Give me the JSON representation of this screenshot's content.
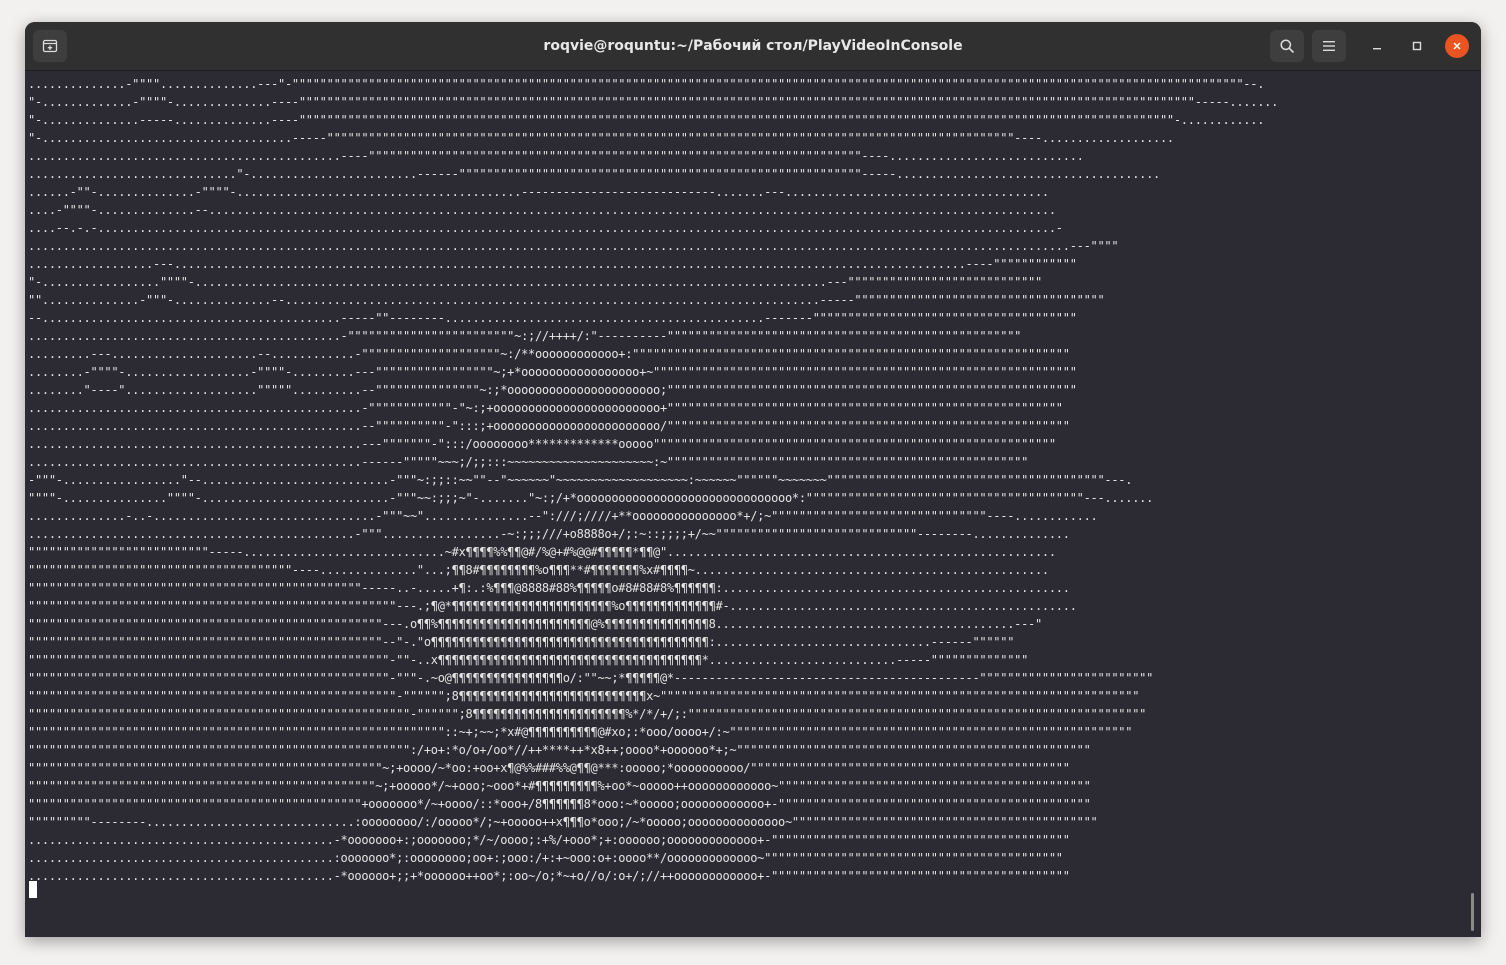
{
  "window": {
    "title": "roqvie@roquntu:~/Рабочий стол/PlayVideoInConsole"
  },
  "icons": {
    "new_tab": "new-tab-icon",
    "search": "search-icon",
    "menu": "hamburger-menu-icon",
    "minimize": "minimize-icon",
    "maximize": "maximize-icon",
    "close": "close-icon"
  },
  "colors": {
    "terminal_background": "#2c2a33",
    "terminal_text": "#e4e4e4",
    "close_button": "#e95420"
  },
  "terminal": {
    "lines": [
      "..............-\"\"\"\"..............---\"-\"\"\"\"\"\"\"\"\"\"\"\"\"\"\"\"\"\"\"\"\"\"\"\"\"\"\"\"\"\"\"\"\"\"\"\"\"\"\"\"\"\"\"\"\"\"\"\"\"\"\"\"\"\"\"\"\"\"\"\"\"\"\"\"\"\"\"\"\"\"\"\"\"\"\"\"\"\"\"\"\"\"\"\"\"\"\"\"\"\"\"\"\"\"\"\"\"\"\"\"\"\"\"\"\"\"\"\"\"\"\"\"\"\"\"\"\"\"\"\"\"\"\"\"\"\"\"\"\"\"\"\"\"\"\"\"\"--.",
      "\"-.............-\"\"\"\"-..............----\"\"\"\"\"\"\"\"\"\"\"\"\"\"\"\"\"\"\"\"\"\"\"\"\"\"\"\"\"\"\"\"\"\"\"\"\"\"\"\"\"\"\"\"\"\"\"\"\"\"\"\"\"\"\"\"\"\"\"\"\"\"\"\"\"\"\"\"\"\"\"\"\"\"\"\"\"\"\"\"\"\"\"\"\"\"\"\"\"\"\"\"\"\"\"\"\"\"\"\"\"\"\"\"\"\"\"\"\"\"\"\"\"\"\"\"\"\"\"\"\"\"\"\"\"\"\"\"\"-----.......",
      "\"-..............-----..............----\"\"\"\"\"\"\"\"\"\"\"\"\"\"\"\"\"\"\"\"\"\"\"\"\"\"\"\"\"\"\"\"\"\"\"\"\"\"\"\"\"\"\"\"\"\"\"\"\"\"\"\"\"\"\"\"\"\"\"\"\"\"\"\"\"\"\"\"\"\"\"\"\"\"\"\"\"\"\"\"\"\"\"\"\"\"\"\"\"\"\"\"\"\"\"\"\"\"\"\"\"\"\"\"\"\"\"\"\"\"\"\"\"\"\"\"\"\"\"\"\"\"\"\"\"\"-............",
      "\"-....................................-----\"\"\"\"\"\"\"\"\"\"\"\"\"\"\"\"\"\"\"\"\"\"\"\"\"\"\"\"\"\"\"\"\"\"\"\"\"\"\"\"\"\"\"\"\"\"\"\"\"\"\"\"\"\"\"\"\"\"\"\"\"\"\"\"\"\"\"\"\"\"\"\"\"\"\"\"\"\"\"\"\"\"\"\"\"\"\"\"\"\"\"\"\"\"\"\"\"\"\"----...................",
      ".............................................----\"\"\"\"\"\"\"\"\"\"\"\"\"\"\"\"\"\"\"\"\"\"\"\"\"\"\"\"\"\"\"\"\"\"\"\"\"\"\"\"\"\"\"\"\"\"\"\"\"\"\"\"\"\"\"\"\"\"\"\"\"\"\"\"\"\"\"\"\"\"\"----............................",
      "..............................\"-........................------\"\"\"\"\"\"\"\"\"\"\"\"\"\"\"\"\"\"\"\"\"\"\"\"\"\"\"\"\"\"\"\"\"\"\"\"\"\"\"\"\"\"\"\"\"\"\"\"\"\"\"\"\"\"\"\"\"\"-----......................................",
      "......-\"\"-..............-\"\"\"\"-.........................................----------------------------.......---......................................",
      "....-\"\"\"\"-..............--..........................................................................................................................",
      "....--.-.-..........................................................................................................................................-",
      "......................................................................................................................................................---\"\"\"\"",
      "..................---..................................................................................................................----\"\"\"\"\"\"\"\"\"\"\"\"",
      "\"-.................\"\"\"\"-...........................................................................................---\"\"\"\"\"\"\"\"\"\"\"\"\"\"\"\"\"\"\"\"\"\"\"\"\"\"\"\"",
      "\"\"..............-\"\"\"-..............--.............................................................................-----\"\"\"\"\"\"\"\"\"\"\"\"\"\"\"\"\"\"\"\"\"\"\"\"\"\"\"\"\"\"\"\"\"\"\"\"",
      "--...........................................-----\"\"--------..............................................-------\"\"\"\"\"\"\"\"\"\"\"\"\"\"\"\"\"\"\"\"\"\"\"\"\"\"\"\"\"\"\"\"\"\"\"\"\"\"",
      ".............................................-\"\"\"\"\"\"\"\"\"\"\"\"\"\"\"\"\"\"\"\"\"\"\"\"~:;//++++/:\"----------\"\"\"\"\"\"\"\"\"\"\"\"\"\"\"\"\"\"\"\"\"\"\"\"\"\"\"\"\"\"\"\"\"\"\"\"\"\"\"\"\"\"\"\"\"\"\"\"\"\"\"",
      ".........---.....................--............-\"\"\"\"\"\"\"\"\"\"\"\"\"\"\"\"\"\"\"\"~:/**oooooooooooo+:\"\"\"\"\"\"\"\"\"\"\"\"\"\"\"\"\"\"\"\"\"\"\"\"\"\"\"\"\"\"\"\"\"\"\"\"\"\"\"\"\"\"\"\"\"\"\"\"\"\"\"\"\"\"\"\"\"\"\"\"\"\"\"",
      "........-\"\"\"\"-..................-\"\"\"\"-.........---\"\"\"\"\"\"\"\"\"\"\"\"\"\"\"\"\"~;+*ooooooooooooooooo+~\"\"\"\"\"\"\"\"\"\"\"\"\"\"\"\"\"\"\"\"\"\"\"\"\"\"\"\"\"\"\"\"\"\"\"\"\"\"\"\"\"\"\"\"\"\"\"\"\"\"\"\"\"\"\"\"\"\"\"\"\"",
      "........\"----\"...................\"\"\"\"\"..........--\"\"\"\"\"\"\"\"\"\"\"\"\"\"\"~:;*oooooooooooooooooooooo;\"\"\"\"\"\"\"\"\"\"\"\"\"\"\"\"\"\"\"\"\"\"\"\"\"\"\"\"\"\"\"\"\"\"\"\"\"\"\"\"\"\"\"\"\"\"\"\"\"\"\"\"\"\"\"\"\"\"\"",
      "................................................-\"\"\"\"\"\"\"\"\"\"\"\"-\"~:;+oooooooooooooooooooooooo+\"\"\"\"\"\"\"\"\"\"\"\"\"\"\"\"\"\"\"\"\"\"\"\"\"\"\"\"\"\"\"\"\"\"\"\"\"\"\"\"\"\"\"\"\"\"\"\"\"\"\"\"\"\"\"\"\"",
      "................................................--\"\"\"\"\"\"\"\"\"\"-\":::;+oooooooooooooooooooooooo/\"\"\"\"\"\"\"\"\"\"\"\"\"\"\"\"\"\"\"\"\"\"\"\"\"\"\"\"\"\"\"\"\"\"\"\"\"\"\"\"\"\"\"\"\"\"\"\"\"\"\"\"\"\"\"\"\"\"",
      "................................................---\"\"\"\"\"\"\"-\":::/oooooooo*************ooooo\"\"\"\"\"\"\"\"\"\"\"\"\"\"\"\"\"\"\"\"\"\"\"\"\"\"\"\"\"\"\"\"\"\"\"\"\"\"\"\"\"\"\"\"\"\"\"\"\"\"\"\"\"\"\"\"\"\"",
      "................................................------\"\"\"\"\"~~~;/;;:::~~~~~~~~~~~~~~~~~~~~~:~\"\"\"\"\"\"\"\"\"\"\"\"\"\"\"\"\"\"\"\"\"\"\"\"\"\"\"\"\"\"\"\"\"\"\"\"\"\"\"\"\"\"\"\"\"\"\"\"\"\"\"\"",
      "-\"\"\"-.................\"--...........................-\"\"\"~:;;::~~\"\"--\"~~~~~~\"~~~~~~~~~~~~~~~~~~~:~~~~~~\"\"\"\"\"\"~~~~~~~\"\"\"\"\"\"\"\"\"\"\"\"\"\"\"\"\"\"\"\"\"\"\"\"\"\"\"\"\"\"\"\"\"\"\"\"\"\"\"\"---.",
      "\"\"\"\"-...............\"\"\"\"-...........................-\"\"\"~~:;;;~\"-.......\"~:;/+*ooooooooooooooooooooooooooooooo*:\"\"\"\"\"\"\"\"\"\"\"\"\"\"\"\"\"\"\"\"\"\"\"\"\"\"\"\"\"\"\"\"\"\"\"\"\"\"\"\"---.......",
      "..............-..-................................-\"\"\"~~\"...............--\":///;////+**ooooooooooooooo*+/;~\"\"\"\"\"\"\"\"\"\"\"\"\"\"\"\"\"\"\"\"\"\"\"\"\"\"\"\"\"\"\"----............",
      "...............................................-\"\"\".................-~:;;;///+o8888o+/;:~::;;;;+/~~\"\"\"\"\"\"\"\"\"\"\"\"\"\"\"\"\"\"\"\"\"\"\"\"\"\"\"\"\"--------..............",
      "\"\"\"\"\"\"\"\"\"\"\"\"\"\"\"\"\"\"\"\"\"\"\"\"\"\"-----.............................~#x¶¶¶¶%%¶¶@#/%@+#%@@#¶¶¶¶¶*¶¶@\"........................................................",
      "\"\"\"\"\"\"\"\"\"\"\"\"\"\"\"\"\"\"\"\"\"\"\"\"\"\"\"\"\"\"\"\"\"\"\"\"\"\"----..............\"...;¶¶8#¶¶¶¶¶¶¶¶%o¶¶¶**#¶¶¶¶¶¶¶%x#¶¶¶¶~...................................................",
      "\"\"\"\"\"\"\"\"\"\"\"\"\"\"\"\"\"\"\"\"\"\"\"\"\"\"\"\"\"\"\"\"\"\"\"\"\"\"\"\"\"\"\"\"\"\"\"\"-----..-.....+¶:.:%¶¶¶@8888#88%¶¶¶¶¶o#8#88#8%¶¶¶¶¶¶:..................................................",
      "\"\"\"\"\"\"\"\"\"\"\"\"\"\"\"\"\"\"\"\"\"\"\"\"\"\"\"\"\"\"\"\"\"\"\"\"\"\"\"\"\"\"\"\"\"\"\"\"\"\"\"\"\"---.;¶@*¶¶¶¶¶¶¶¶¶¶¶¶¶¶¶¶¶¶¶¶¶¶¶%o¶¶¶¶¶¶¶¶¶¶¶¶¶#-..................................................",
      "\"\"\"\"\"\"\"\"\"\"\"\"\"\"\"\"\"\"\"\"\"\"\"\"\"\"\"\"\"\"\"\"\"\"\"\"\"\"\"\"\"\"\"\"\"\"\"\"\"\"\"---.o¶¶%¶¶¶¶¶¶¶¶¶¶¶¶¶¶¶¶¶¶¶¶¶¶@%¶¶¶¶¶¶¶¶¶¶¶¶¶¶¶8...........................................---\"",
      "\"\"\"\"\"\"\"\"\"\"\"\"\"\"\"\"\"\"\"\"\"\"\"\"\"\"\"\"\"\"\"\"\"\"\"\"\"\"\"\"\"\"\"\"\"\"\"\"\"\"\"--\"-.\"o¶¶¶¶¶¶¶¶¶¶¶¶¶¶¶¶¶¶¶¶¶¶¶¶¶¶¶¶¶¶¶¶¶¶¶¶¶¶¶¶:...............................------\"\"\"\"\"\"",
      "\"\"\"\"\"\"\"\"\"\"\"\"\"\"\"\"\"\"\"\"\"\"\"\"\"\"\"\"\"\"\"\"\"\"\"\"\"\"\"\"\"\"\"\"\"\"\"\"\"\"\"\"-\"\"-..x¶¶¶¶¶¶¶¶¶¶¶¶¶¶¶¶¶¶¶¶¶¶¶¶¶¶¶¶¶¶¶¶¶¶¶¶¶¶*...........................-----\"\"\"\"\"\"\"\"\"\"\"\"\"\"",
      "\"\"\"\"\"\"\"\"\"\"\"\"\"\"\"\"\"\"\"\"\"\"\"\"\"\"\"\"\"\"\"\"\"\"\"\"\"\"\"\"\"\"\"\"\"\"\"\"\"\"\"\"-\"\"\"-.~o@¶¶¶¶¶¶¶¶¶¶¶¶¶¶¶¶o/:\"\"~~;*¶¶¶¶¶@*--------------------------------------------\"\"\"\"\"\"\"\"\"\"\"\"\"\"\"\"\"\"\"\"\"\"\"\"\"",
      "\"\"\"\"\"\"\"\"\"\"\"\"\"\"\"\"\"\"\"\"\"\"\"\"\"\"\"\"\"\"\"\"\"\"\"\"\"\"\"\"\"\"\"\"\"\"\"\"\"\"\"\"\"-\"\"\"\"\"\";8¶¶¶¶¶¶¶¶¶¶¶¶¶¶¶¶¶¶¶¶¶¶¶¶¶¶¶x~\"\"\"\"\"\"\"\"\"\"\"\"\"\"\"\"\"\"\"\"\"\"\"\"\"\"\"\"\"\"\"\"\"\"\"\"\"\"\"\"\"\"\"\"\"\"\"\"\"\"\"\"\"\"\"\"\"\"\"\"\"\"\"\"\"\"\"\"\"",
      "\"\"\"\"\"\"\"\"\"\"\"\"\"\"\"\"\"\"\"\"\"\"\"\"\"\"\"\"\"\"\"\"\"\"\"\"\"\"\"\"\"\"\"\"\"\"\"\"\"\"\"\"\"\"\"-\"\"\"\"\"\";8¶¶¶¶¶¶¶¶¶¶¶¶¶¶¶¶¶¶¶¶¶¶%*/*/+/;:\"\"\"\"\"\"\"\"\"\"\"\"\"\"\"\"\"\"\"\"\"\"\"\"\"\"\"\"\"\"\"\"\"\"\"\"\"\"\"\"\"\"\"\"\"\"\"\"\"\"\"\"\"\"\"\"\"\"\"\"\"\"\"\"\"\"",
      "\"\"\"\"\"\"\"\"\"\"\"\"\"\"\"\"\"\"\"\"\"\"\"\"\"\"\"\"\"\"\"\"\"\"\"\"\"\"\"\"\"\"\"\"\"\"\"\"\"\"\"\"\"\"\"\"\"\"\"\"::~+;~~;*x#@¶¶¶¶¶¶¶¶¶¶@#xo;:*ooo/oooo+/:~\"\"\"\"\"\"\"\"\"\"\"\"\"\"\"\"\"\"\"\"\"\"\"\"\"\"\"\"\"\"\"\"\"\"\"\"\"\"\"\"\"\"\"\"\"\"\"\"\"\"\"\"\"\"\"\"\"\"",
      "\"\"\"\"\"\"\"\"\"\"\"\"\"\"\"\"\"\"\"\"\"\"\"\"\"\"\"\"\"\"\"\"\"\"\"\"\"\"\"\"\"\"\"\"\"\"\"\"\"\"\"\"\"\"\":/+o+:*o/o+/oo*//++****++*x8++;oooo*+oooooo*+;~\"\"\"\"\"\"\"\"\"\"\"\"\"\"\"\"\"\"\"\"\"\"\"\"\"\"\"\"\"\"\"\"\"\"\"\"\"\"\"\"\"\"\"\"\"\"\"\"\"\"\"",
      "\"\"\"\"\"\"\"\"\"\"\"\"\"\"\"\"\"\"\"\"\"\"\"\"\"\"\"\"\"\"\"\"\"\"\"\"\"\"\"\"\"\"\"\"\"\"\"\"\"\"\"~;+oooo/~*oo:+oo+x¶@%%###%%@¶¶@***:ooooo;*oooooooooo/\"\"\"\"\"\"\"\"\"\"\"\"\"\"\"\"\"\"\"\"\"\"\"\"\"\"\"\"\"\"\"\"\"\"\"\"\"\"\"\"\"\"\"\"\"\"",
      "\"\"\"\"\"\"\"\"\"\"\"\"\"\"\"\"\"\"\"\"\"\"\"\"\"\"\"\"\"\"\"\"\"\"\"\"\"\"\"\"\"\"\"\"\"\"\"\"\"\"~;+ooooo*/~+ooo;~ooo*+#¶¶¶¶¶¶¶¶¶%+oo*~ooooo++oooooooooooo~\"\"\"\"\"\"\"\"\"\"\"\"\"\"\"\"\"\"\"\"\"\"\"\"\"\"\"\"\"\"\"\"\"\"\"\"\"\"\"\"\"\"\"\"\"",
      "\"\"\"\"\"\"\"\"\"\"\"\"\"\"\"\"\"\"\"\"\"\"\"\"\"\"\"\"\"\"\"\"\"\"\"\"\"\"\"\"\"\"\"\"\"\"\"\"+ooooooo*/~+oooo/::*ooo+/8¶¶¶¶¶¶8*ooo:~*ooooo;oooooooooooo+-\"\"\"\"\"\"\"\"\"\"\"\"\"\"\"\"\"\"\"\"\"\"\"\"\"\"\"\"\"\"\"\"\"\"\"\"\"\"\"\"\"\"\"\"\"",
      "\"\"\"\"\"\"\"\"\"--------..............................:oooooooo/:/ooooo*/;~+ooooo++x¶¶¶o*ooo;/~*ooooo;oooooooooooooo~\"\"\"\"\"\"\"\"\"\"\"\"\"\"\"\"\"\"\"\"\"\"\"\"\"\"\"\"\"\"\"\"\"\"\"\"\"\"\"\"\"\"\"\"",
      "............................................-*ooooooo+:;ooooooo;*/~/oooo;:+%/+ooo*;+:oooooo;ooooooooooooo+-\"\"\"\"\"\"\"\"\"\"\"\"\"\"\"\"\"\"\"\"\"\"\"\"\"\"\"\"\"\"\"\"\"\"\"\"\"\"\"\"\"\"\"",
      "............................................:ooooooo*;:oooooooo;oo+:;ooo:/+:+~ooo:o+:oooo**/ooooooooooooo~\"\"\"\"\"\"\"\"\"\"\"\"\"\"\"\"\"\"\"\"\"\"\"\"\"\"\"\"\"\"\"\"\"\"\"\"\"\"\"\"\"\"\"",
      "............................................-*oooooo+;;+*oooooo++oo*;:oo~/o;*~+o//o/:o+/;//++oooooooooooo+-\"\"\"\"\"\"\"\"\"\"\"\"\"\"\"\"\"\"\"\"\"\"\"\"\"\"\"\"\"\"\"\"\"\"\"\"\"\"\"\"\"\"\""
    ]
  }
}
